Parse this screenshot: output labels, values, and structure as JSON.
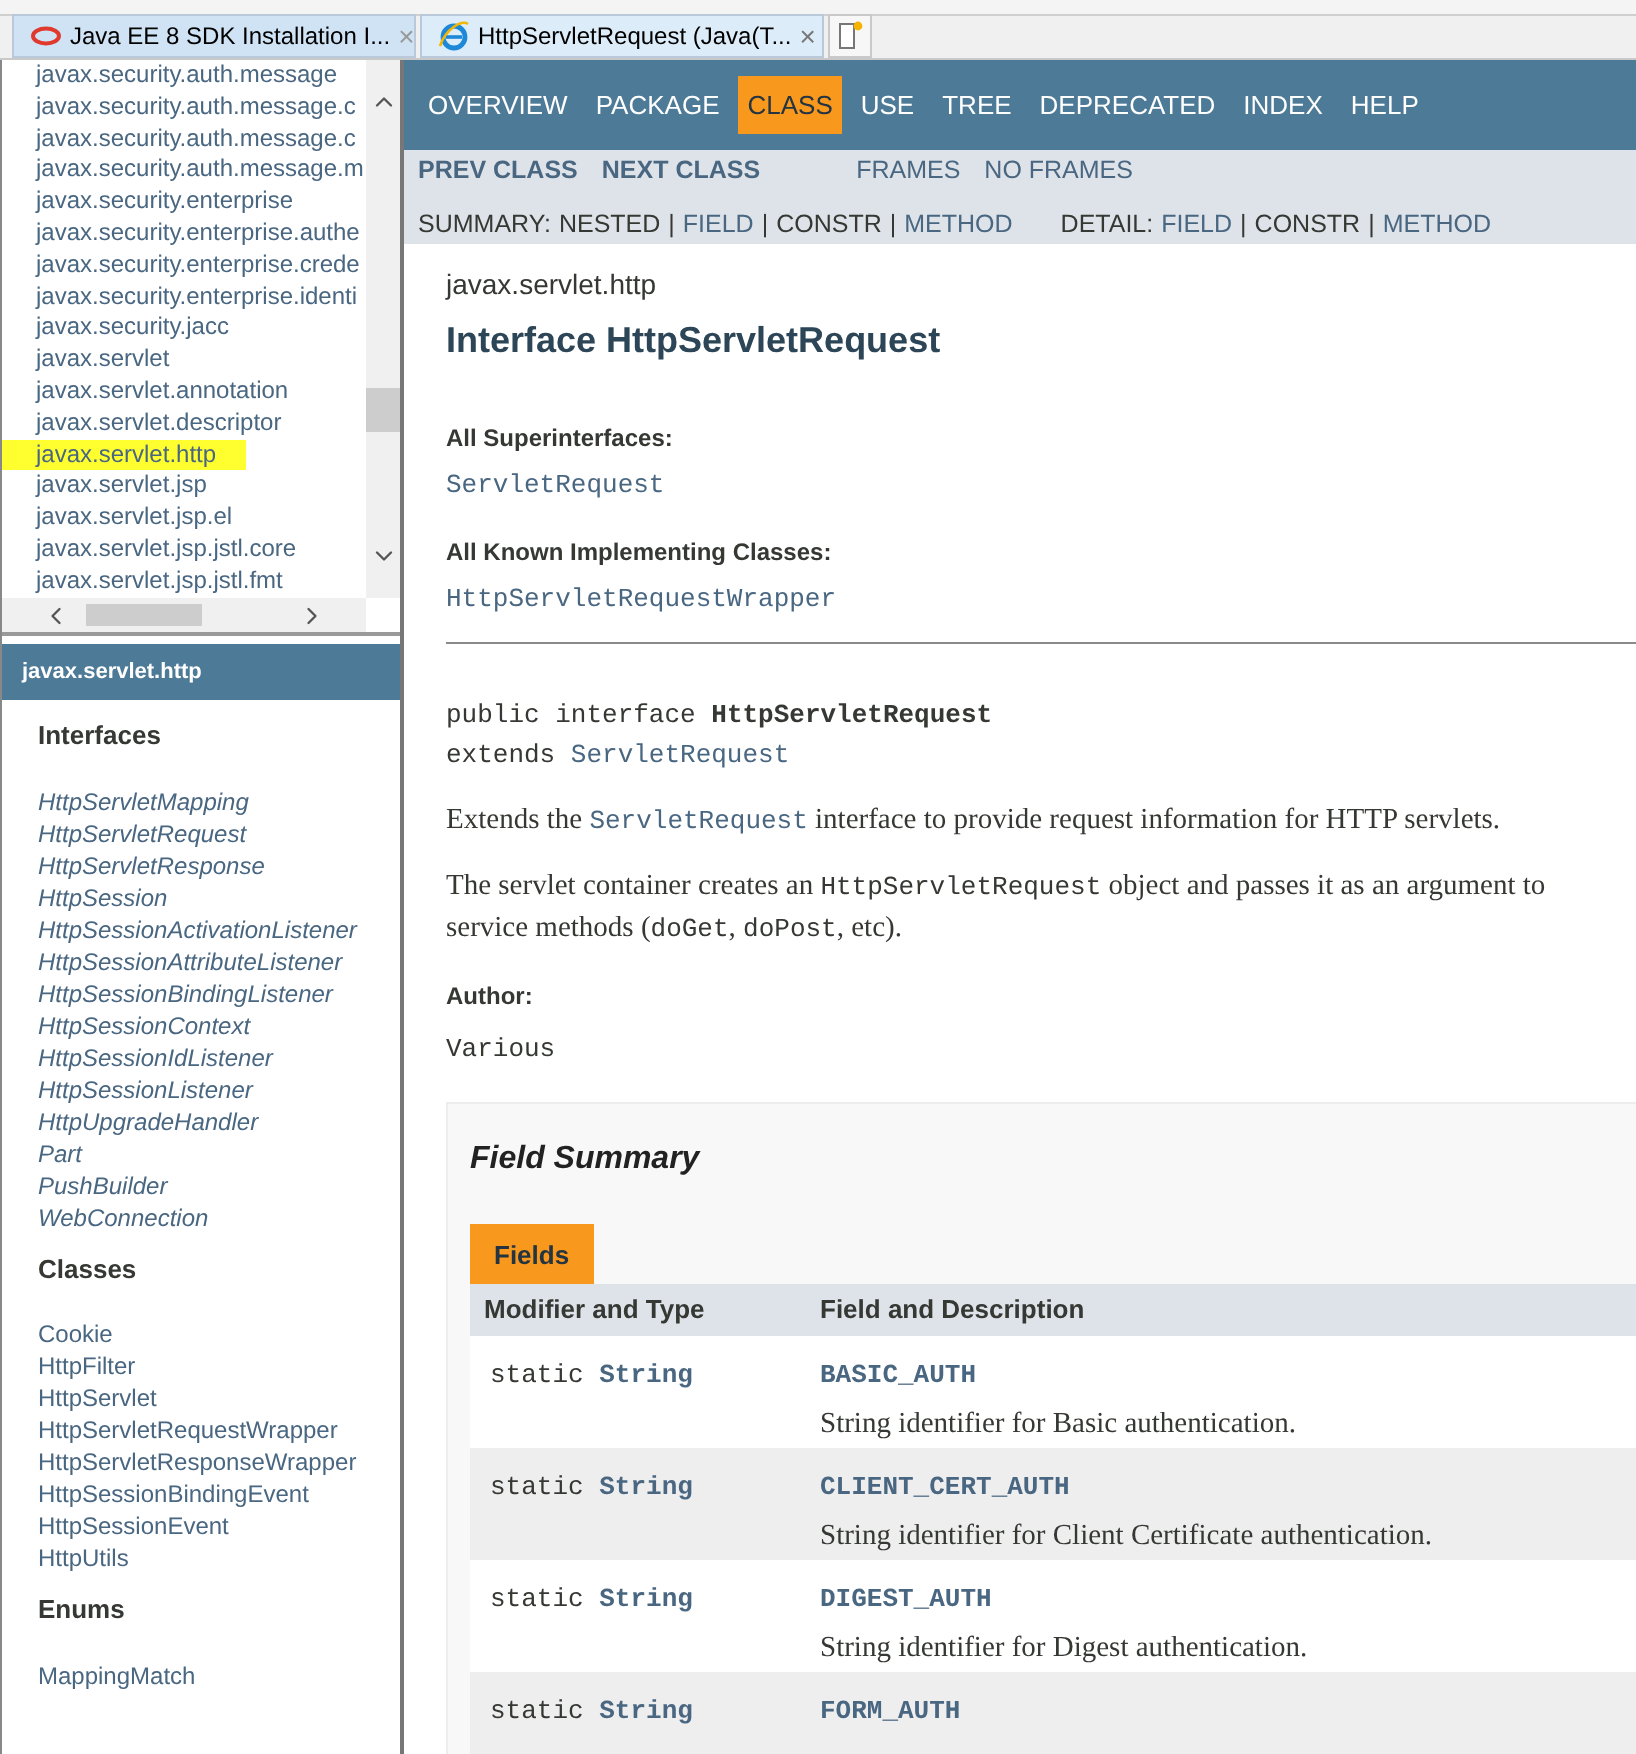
{
  "browser_tabs": [
    {
      "kind": "oracle",
      "title": "Java EE 8 SDK Installation I...",
      "close": "×",
      "selected": false
    },
    {
      "kind": "ie",
      "title": "HttpServletRequest (Java(T...",
      "close": "×",
      "selected": true
    }
  ],
  "packages": [
    {
      "name": "javax.security.auth.message",
      "selected": false
    },
    {
      "name": "javax.security.auth.message.c",
      "selected": false
    },
    {
      "name": "javax.security.auth.message.c",
      "selected": false
    },
    {
      "name": "javax.security.auth.message.m",
      "selected": false
    },
    {
      "name": "javax.security.enterprise",
      "selected": false
    },
    {
      "name": "javax.security.enterprise.authe",
      "selected": false
    },
    {
      "name": "javax.security.enterprise.crede",
      "selected": false
    },
    {
      "name": "javax.security.enterprise.identi",
      "selected": false
    },
    {
      "name": "javax.security.jacc",
      "selected": false
    },
    {
      "name": "javax.servlet",
      "selected": false
    },
    {
      "name": "javax.servlet.annotation",
      "selected": false
    },
    {
      "name": "javax.servlet.descriptor",
      "selected": false
    },
    {
      "name": "javax.servlet.http",
      "selected": true
    },
    {
      "name": "javax.servlet.jsp",
      "selected": false
    },
    {
      "name": "javax.servlet.jsp.el",
      "selected": false
    },
    {
      "name": "javax.servlet.jsp.jstl.core",
      "selected": false
    },
    {
      "name": "javax.servlet.jsp.jstl.fmt",
      "selected": false
    }
  ],
  "package_frame": {
    "title": "javax.servlet.http",
    "sections": [
      {
        "heading": "Interfaces",
        "italic": true,
        "items": [
          "HttpServletMapping",
          "HttpServletRequest",
          "HttpServletResponse",
          "HttpSession",
          "HttpSessionActivationListener",
          "HttpSessionAttributeListener",
          "HttpSessionBindingListener",
          "HttpSessionContext",
          "HttpSessionIdListener",
          "HttpSessionListener",
          "HttpUpgradeHandler",
          "Part",
          "PushBuilder",
          "WebConnection"
        ]
      },
      {
        "heading": "Classes",
        "italic": false,
        "items": [
          "Cookie",
          "HttpFilter",
          "HttpServlet",
          "HttpServletRequestWrapper",
          "HttpServletResponseWrapper",
          "HttpSessionBindingEvent",
          "HttpSessionEvent",
          "HttpUtils"
        ]
      },
      {
        "heading": "Enums",
        "italic": false,
        "items": [
          "MappingMatch"
        ]
      }
    ]
  },
  "nav": [
    {
      "label": "OVERVIEW",
      "selected": false
    },
    {
      "label": "PACKAGE",
      "selected": false
    },
    {
      "label": "CLASS",
      "selected": true
    },
    {
      "label": "USE",
      "selected": false
    },
    {
      "label": "TREE",
      "selected": false
    },
    {
      "label": "DEPRECATED",
      "selected": false
    },
    {
      "label": "INDEX",
      "selected": false
    },
    {
      "label": "HELP",
      "selected": false
    }
  ],
  "subnav": {
    "class_links": [
      "PREV CLASS",
      "NEXT CLASS"
    ],
    "frame_links": [
      "FRAMES",
      "NO FRAMES"
    ],
    "summary": {
      "label": "SUMMARY:",
      "separator": "|",
      "items": [
        {
          "text": "NESTED",
          "link": false
        },
        {
          "text": "FIELD",
          "link": true
        },
        {
          "text": "CONSTR",
          "link": false
        },
        {
          "text": "METHOD",
          "link": true
        }
      ]
    },
    "detail": {
      "label": "DETAIL:",
      "separator": "|",
      "items": [
        {
          "text": "FIELD",
          "link": true
        },
        {
          "text": "CONSTR",
          "link": false
        },
        {
          "text": "METHOD",
          "link": true
        }
      ]
    }
  },
  "package_name": "javax.servlet.http",
  "title": "Interface HttpServletRequest",
  "superinterfaces": {
    "label": "All Superinterfaces:",
    "links": [
      "ServletRequest"
    ]
  },
  "implementing": {
    "label": "All Known Implementing Classes:",
    "links": [
      "HttpServletRequestWrapper"
    ]
  },
  "signature": {
    "line1": "public interface",
    "name": "HttpServletRequest",
    "line2": "extends",
    "extends": "ServletRequest"
  },
  "paragraphs": [
    [
      {
        "kind": "text",
        "text": "Extends the"
      },
      {
        "kind": "link",
        "text": "ServletRequest"
      },
      {
        "kind": "text",
        "text": "interface to provide request information for HTTP servlets."
      }
    ],
    [
      {
        "kind": "text",
        "text": "The servlet container creates an"
      },
      {
        "kind": "code",
        "text": "HttpServletRequest"
      },
      {
        "kind": "text",
        "text": "object and passes it as an argument to"
      },
      {
        "kind": "text",
        "text": "service methods ("
      },
      {
        "kind": "code",
        "text": "doGet"
      },
      {
        "kind": "text",
        "text": ", "
      },
      {
        "kind": "code",
        "text": "doPost"
      },
      {
        "kind": "text",
        "text": ", etc)."
      }
    ]
  ],
  "author": {
    "label": "Author:",
    "value": "Various"
  },
  "field_summary": {
    "title": "Field Summary",
    "tab": "Fields",
    "columns": [
      "Modifier and Type",
      "Field and Description"
    ],
    "rows": [
      {
        "modifier": "static",
        "type": "String",
        "name": "BASIC_AUTH",
        "description": "String identifier for Basic authentication."
      },
      {
        "modifier": "static",
        "type": "String",
        "name": "CLIENT_CERT_AUTH",
        "description": "String identifier for Client Certificate authentication."
      },
      {
        "modifier": "static",
        "type": "String",
        "name": "DIGEST_AUTH",
        "description": "String identifier for Digest authentication."
      },
      {
        "modifier": "static",
        "type": "String",
        "name": "FORM_AUTH"
      }
    ]
  }
}
